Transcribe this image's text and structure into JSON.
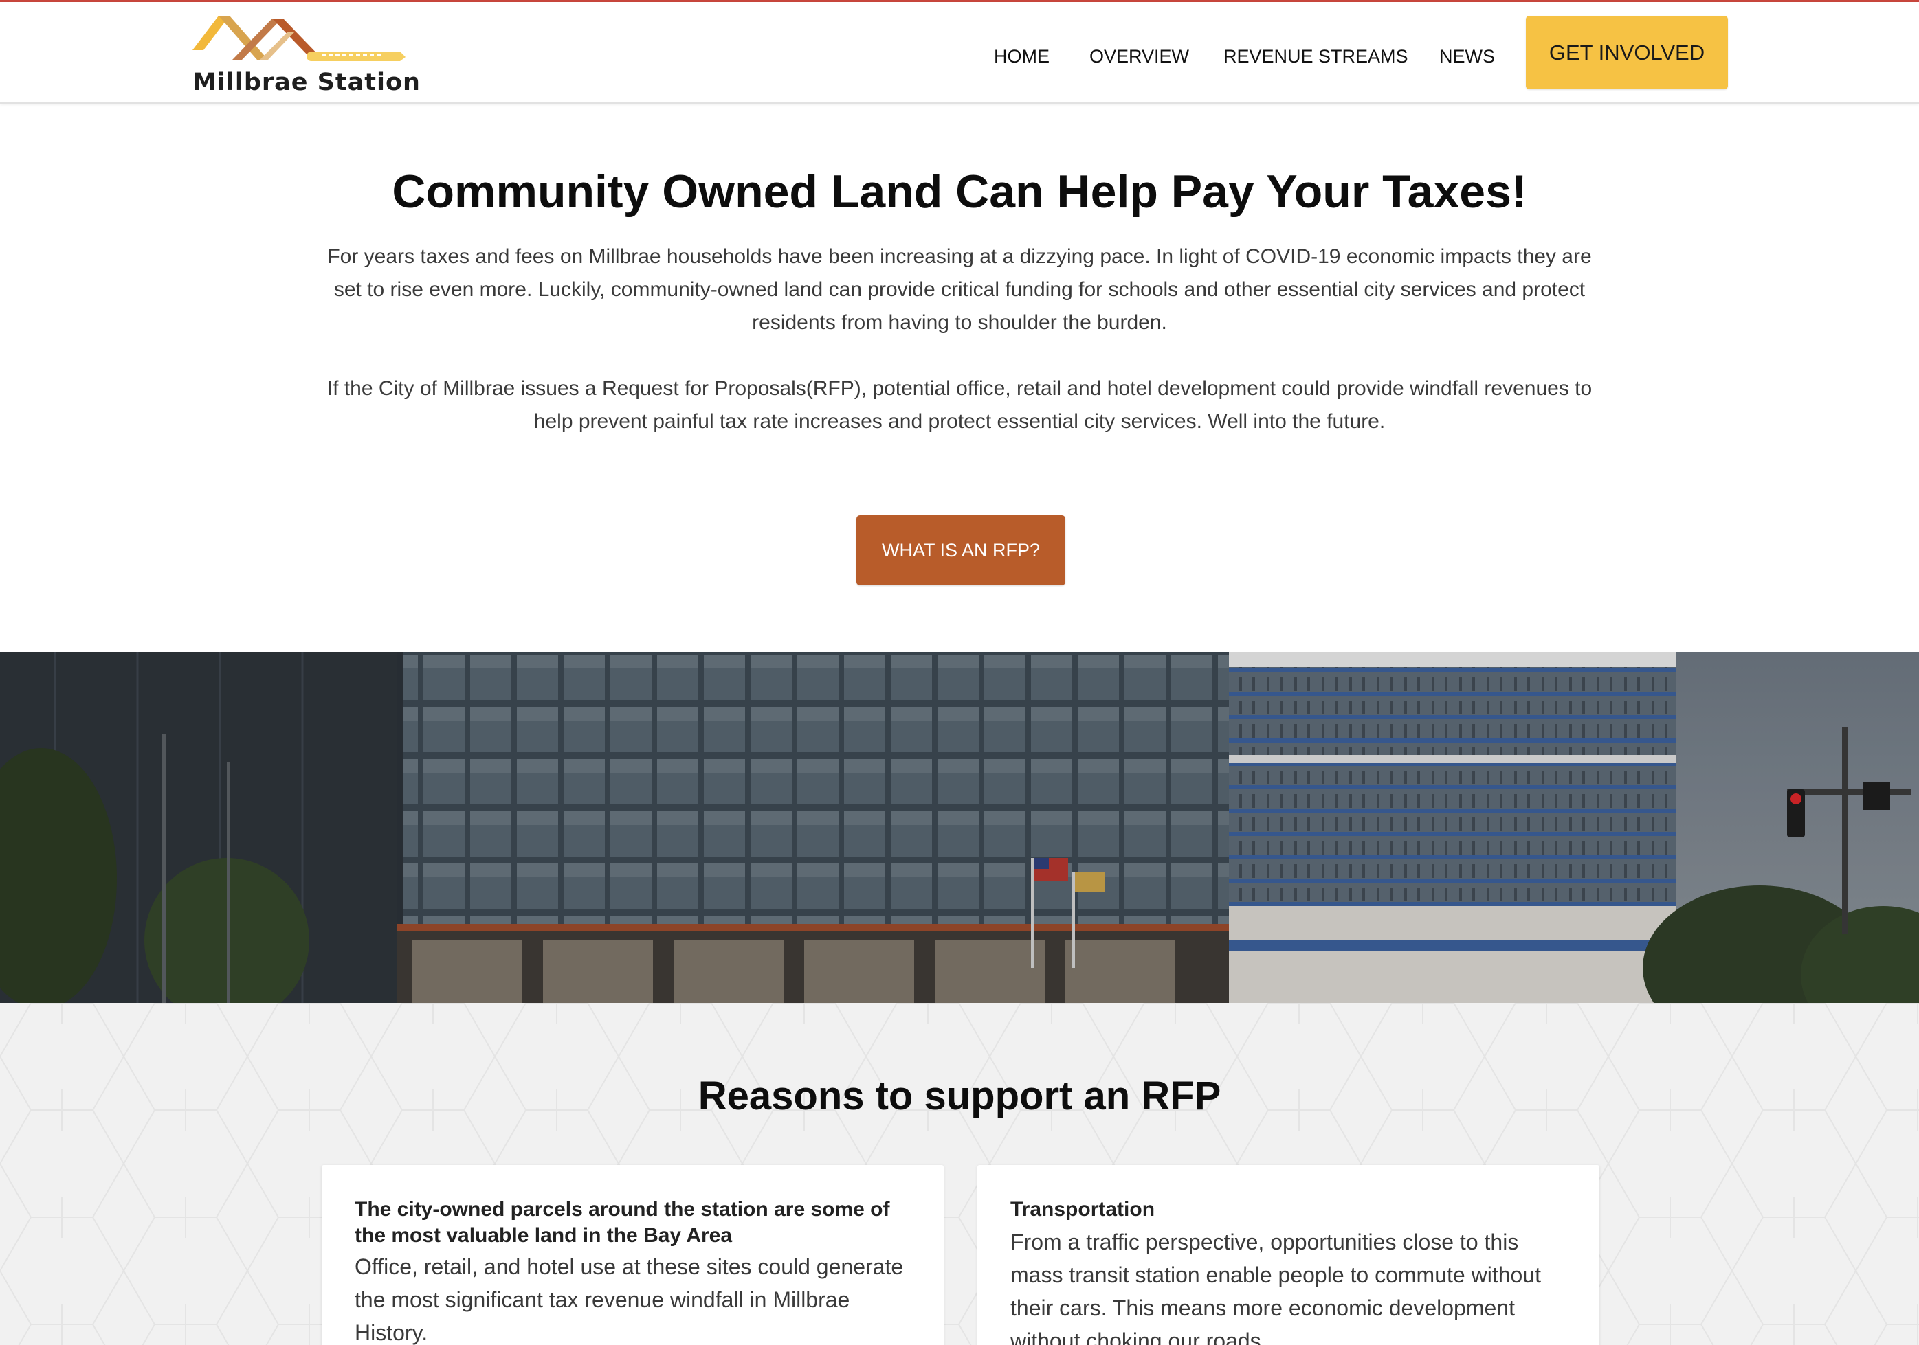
{
  "header": {
    "logo_text": "Millbrae Station",
    "logo_icon": "mountain-train-logo",
    "nav": [
      {
        "label": "HOME"
      },
      {
        "label": "OVERVIEW"
      },
      {
        "label": "REVENUE STREAMS"
      },
      {
        "label": "NEWS"
      }
    ],
    "cta_label": "GET INVOLVED"
  },
  "hero": {
    "title": "Community Owned Land Can Help Pay Your Taxes!",
    "paragraph1": "For years taxes and fees on Millbrae households have been increasing at a dizzying pace. In light of COVID-19 economic impacts they are set to rise even more. Luckily, community-owned land can provide critical funding for schools and other essential city services and protect residents from having to shoulder the burden.",
    "paragraph2": "If the City of Millbrae issues a Request for Proposals(RFP), potential office, retail and hotel development could provide windfall revenues to help prevent painful tax rate increases and protect essential city services. Well into the future.",
    "button_label": "WHAT IS AN RFP?"
  },
  "reasons": {
    "title": "Reasons to support an RFP",
    "cards": [
      {
        "title": "The city-owned parcels around the station are some of the most valuable land in the Bay Area",
        "body": "Office, retail, and hotel use at these sites could generate the most significant tax revenue windfall in Millbrae History."
      },
      {
        "title": "Transportation",
        "body": "From a traffic perspective, opportunities close to this mass transit station enable people to commute without their cars. This means more economic development without choking our roads."
      }
    ]
  },
  "colors": {
    "accent_yellow": "#f6c244",
    "accent_orange": "#b85c2a",
    "top_line": "#c8463c",
    "section_bg": "#f1f1f1"
  }
}
